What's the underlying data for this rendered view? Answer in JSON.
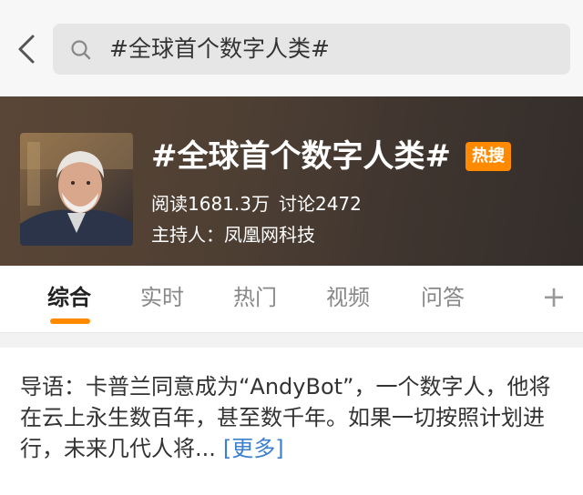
{
  "search": {
    "query": "#全球首个数字人类#"
  },
  "topic": {
    "title": "#全球首个数字人类#",
    "badge": "热搜",
    "reads": "阅读1681.3万",
    "discussions": "讨论2472",
    "host": "主持人：凤凰网科技"
  },
  "tabs": [
    {
      "label": "综合",
      "active": true
    },
    {
      "label": "实时"
    },
    {
      "label": "热门"
    },
    {
      "label": "视频"
    },
    {
      "label": "问答"
    }
  ],
  "tabs_add": "+",
  "intro": {
    "text": "导语：卡普兰同意成为“AndyBot”，一个数字人，他将在云上永生数百年，甚至数千年。如果一切按照计划进行，未来几代人将...",
    "more": "[更多]"
  },
  "icons": {
    "back": "chevron-left-icon",
    "search": "search-icon"
  },
  "colors": {
    "accent": "#ff8a00",
    "link": "#3b7fd0"
  }
}
